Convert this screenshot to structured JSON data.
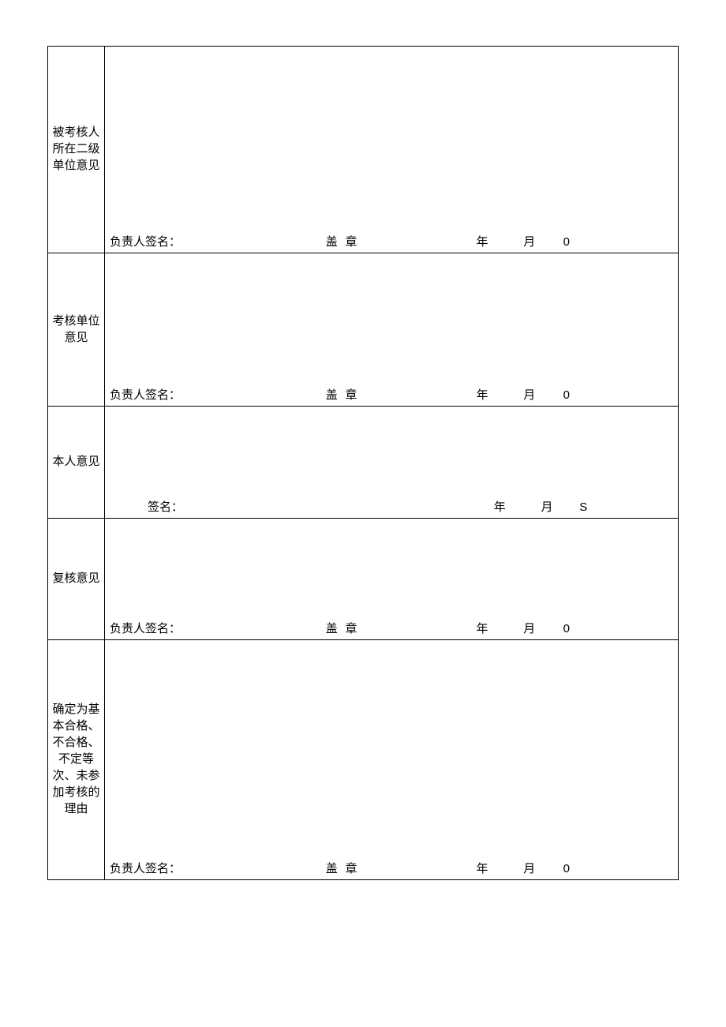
{
  "rows": [
    {
      "label": "被考核人所在二级单位意见",
      "sign_label": "负责人签名：",
      "seal_label": "盖 章",
      "year_label": "年",
      "month_label": "月",
      "day_label": "0",
      "mode": "full"
    },
    {
      "label": "考核单位意见",
      "sign_label": "负责人签名：",
      "seal_label": "盖 章",
      "year_label": "年",
      "month_label": "月",
      "day_label": "0",
      "mode": "full"
    },
    {
      "label": "本人意见",
      "sign_label": "签名：",
      "seal_label": "",
      "year_label": "年",
      "month_label": "月",
      "day_label": "S",
      "mode": "short"
    },
    {
      "label": "复核意见",
      "sign_label": "负责人签名：",
      "seal_label": "盖 章",
      "year_label": "年",
      "month_label": "月",
      "day_label": "0",
      "mode": "full"
    },
    {
      "label": "确定为基本合格、不合格、不定等次、未参加考核的理由",
      "sign_label": "负责人签名：",
      "seal_label": "盖 章",
      "year_label": "年",
      "month_label": "月",
      "day_label": "0",
      "mode": "full"
    }
  ]
}
